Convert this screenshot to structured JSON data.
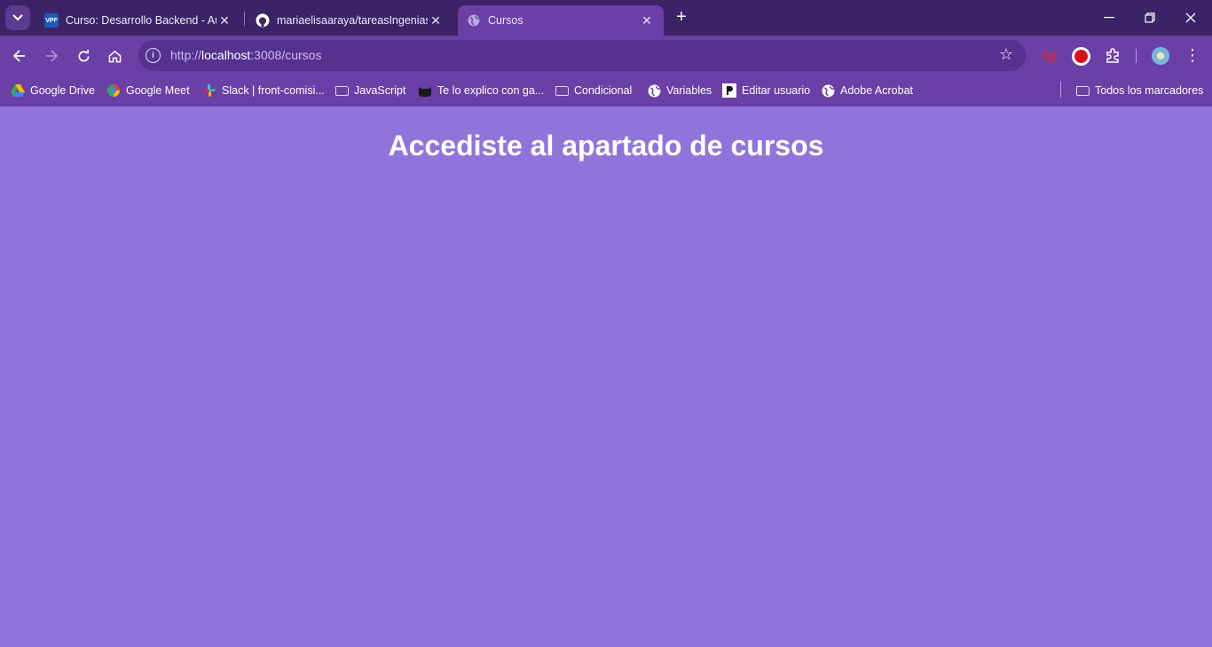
{
  "browser": {
    "tabs": [
      {
        "title": "Curso: Desarrollo Backend - Aul",
        "favicon": "vpf-icon",
        "favicon_text": "VPF"
      },
      {
        "title": "mariaelisaaraya/tareasIngenias/",
        "favicon": "github-icon"
      },
      {
        "title": "Cursos",
        "favicon": "globe-icon",
        "active": true
      }
    ],
    "new_tab_label": "+",
    "address": {
      "scheme": "http://",
      "host": "localhost",
      "path": ":3008/cursos"
    },
    "bookmarks": [
      {
        "label": "Google Drive",
        "icon": "google-drive-icon"
      },
      {
        "label": "Google Meet",
        "icon": "google-meet-icon"
      },
      {
        "label": "Slack | front-comisi...",
        "icon": "slack-icon"
      },
      {
        "label": "JavaScript",
        "icon": "folder-icon"
      },
      {
        "label": "Te lo explico con ga...",
        "icon": "cat-icon"
      },
      {
        "label": "Condicional",
        "icon": "folder-icon"
      },
      {
        "label": "Variables",
        "icon": "globe-icon"
      },
      {
        "label": "Editar usuario",
        "icon": "p-icon"
      },
      {
        "label": "Adobe Acrobat",
        "icon": "globe-icon"
      }
    ],
    "all_bookmarks_label": "Todos los marcadores",
    "extensions": {
      "tp_label": "Tp"
    }
  },
  "page": {
    "heading": "Accediste al apartado de cursos",
    "background_color": "#9174db",
    "heading_color": "#ffffff"
  }
}
